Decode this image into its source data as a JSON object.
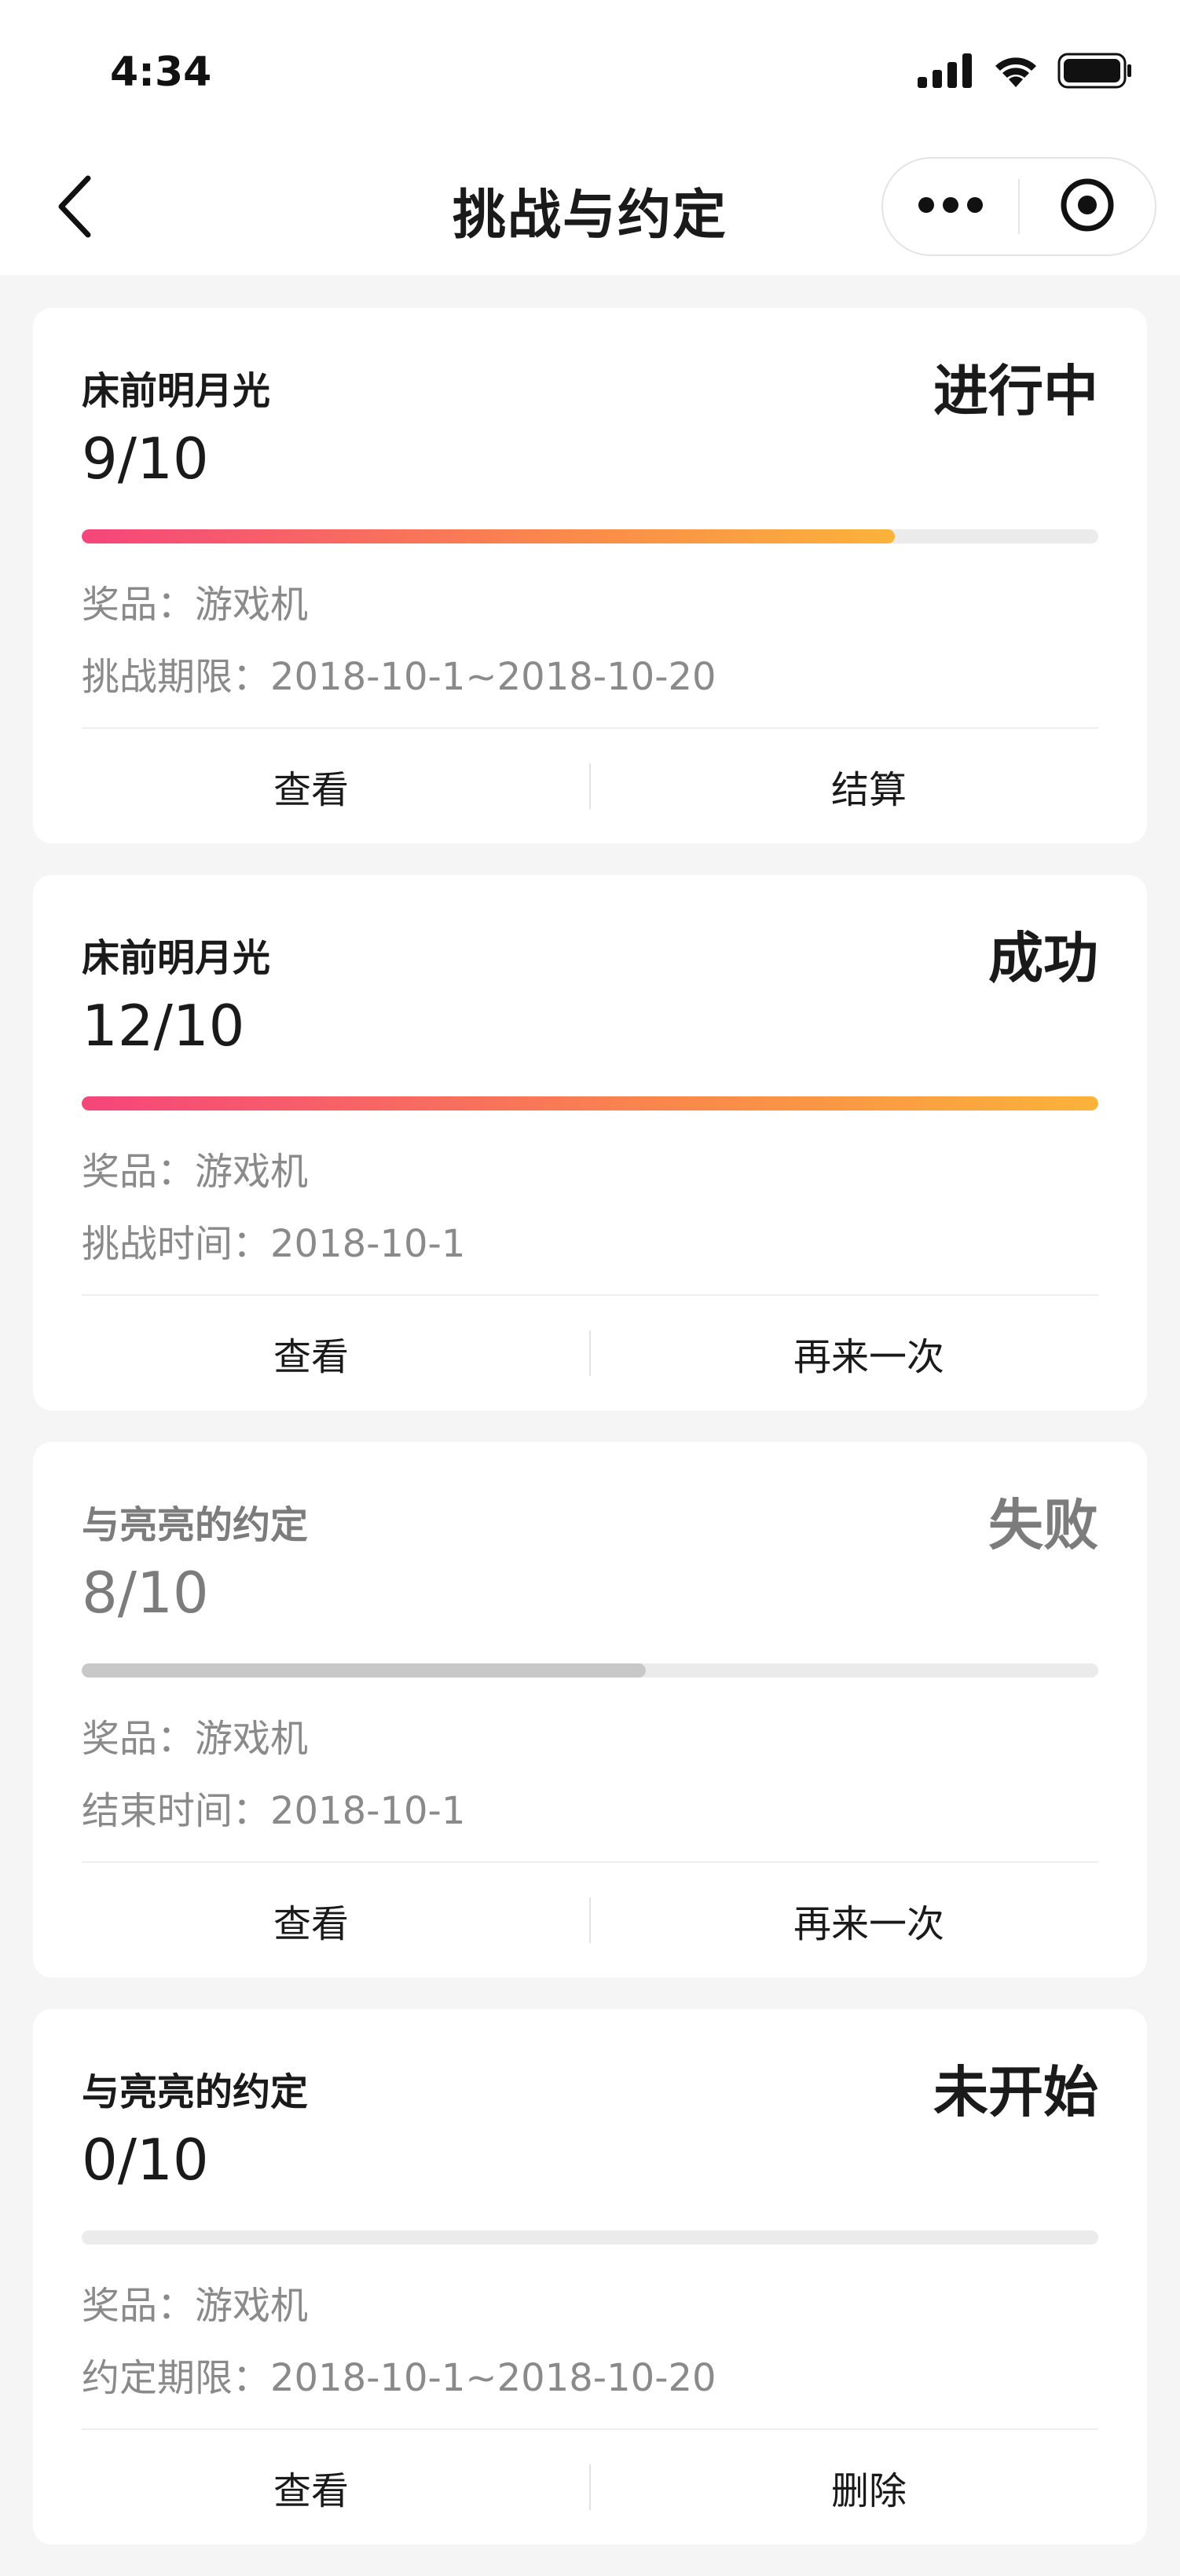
{
  "status_bar": {
    "time": "4:34",
    "icons": [
      "cellular-signal-icon",
      "wifi-icon",
      "battery-icon"
    ]
  },
  "nav": {
    "back_icon": "chevron-left-icon",
    "title": "挑战与约定",
    "more_icon": "more-dots-icon",
    "close_icon": "target-close-icon"
  },
  "colors": {
    "progress_gradient": [
      "#f5457b",
      "#fa8a4a",
      "#fbb33a"
    ],
    "progress_failed": "#c8c8c8",
    "track": "#ebebeb",
    "muted_text": "#8a8a8a"
  },
  "cards": [
    {
      "name": "床前明月光",
      "status": "进行中",
      "progress_text": "9/10",
      "progress_value": 0.8,
      "progress_style": "gradient",
      "prize": "奖品：游戏机",
      "date": "挑战期限：2018-10-1~2018-10-20",
      "actions": [
        "查看",
        "结算"
      ]
    },
    {
      "name": "床前明月光",
      "status": "成功",
      "progress_text": "12/10",
      "progress_value": 1.0,
      "progress_style": "gradient",
      "prize": "奖品：游戏机",
      "date": "挑战时间：2018-10-1",
      "actions": [
        "查看",
        "再来一次"
      ]
    },
    {
      "name": "与亮亮的约定",
      "status": "失败",
      "progress_text": "8/10",
      "progress_value": 0.555,
      "progress_style": "grey",
      "prize": "奖品：游戏机",
      "date": "结束时间：2018-10-1",
      "actions": [
        "查看",
        "再来一次"
      ]
    },
    {
      "name": "与亮亮的约定",
      "status": "未开始",
      "progress_text": "0/10",
      "progress_value": 0,
      "progress_style": "gradient",
      "prize": "奖品：游戏机",
      "date": "约定期限：2018-10-1~2018-10-20",
      "actions": [
        "查看",
        "删除"
      ]
    }
  ]
}
